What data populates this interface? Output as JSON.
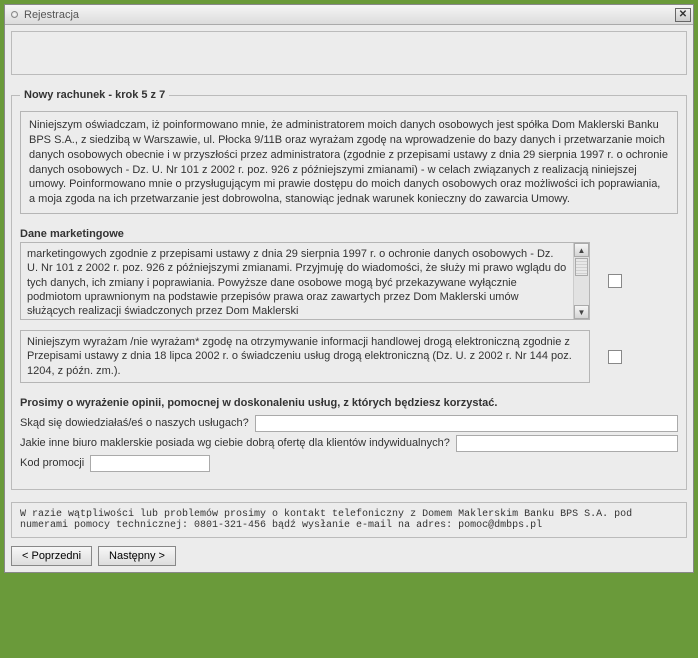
{
  "window": {
    "title": "Rejestracja"
  },
  "step": {
    "legend": "Nowy rachunek - krok 5 z 7"
  },
  "declaration": "Niniejszym oświadczam, iż poinformowano mnie, że administratorem moich danych osobowych jest spółka Dom Maklerski Banku BPS S.A., z siedzibą w Warszawie, ul. Płocka 9/11B oraz wyrażam zgodę na wprowadzenie do bazy danych i przetwarzanie moich danych osobowych obecnie i w przyszłości przez administratora (zgodnie z przepisami ustawy z dnia 29 sierpnia 1997 r. o ochronie danych osobowych - Dz. U. Nr 101 z 2002 r. poz. 926 z późniejszymi zmianami) - w celach związanych z realizacją niniejszej umowy. Poinformowano mnie o przysługującym mi prawie dostępu do moich danych osobowych oraz możliwości ich poprawiania, a moja zgoda na ich przetwarzanie jest dobrowolna, stanowiąc jednak warunek konieczny do zawarcia Umowy.",
  "marketing": {
    "label": "Dane marketingowe",
    "text": "marketingowych zgodnie z przepisami ustawy z dnia 29 sierpnia 1997 r. o ochronie danych osobowych - Dz. U. Nr 101 z 2002 r. poz. 926 z późniejszymi zmianami. Przyjmuję do wiadomości, że służy mi prawo wglądu do tych danych, ich zmiany i poprawiania. Powyższe dane osobowe mogą być przekazywane wyłącznie podmiotom uprawnionym na podstawie przepisów prawa oraz zawartych przez Dom Maklerski umów służących realizacji świadczonych przez Dom Maklerski"
  },
  "consent2": "Niniejszym wyrażam /nie wyrażam* zgodę na otrzymywanie informacji handlowej drogą elektroniczną zgodnie z Przepisami ustawy z dnia 18 lipca 2002 r. o świadczeniu usług drogą elektroniczną (Dz. U. z 2002 r. Nr 144 poz. 1204, z późn. zm.).",
  "feedback": {
    "heading": "Prosimy o wyrażenie opinii, pomocnej w doskonaleniu usług, z których będziesz korzystać.",
    "q1": "Skąd się dowiedziałaś/eś o naszych usługach?",
    "q2": "Jakie inne biuro maklerskie posiada wg ciebie dobrą ofertę dla klientów indywidualnych?",
    "q3": "Kod promocji"
  },
  "footer": "W razie wątpliwości lub problemów prosimy o kontakt telefoniczny z Domem Maklerskim Banku BPS S.A. pod numerami pomocy technicznej: 0801-321-456 bądź wysłanie e-mail na adres: pomoc@dmbps.pl",
  "buttons": {
    "prev": "< Poprzedni",
    "next": "Następny >"
  }
}
